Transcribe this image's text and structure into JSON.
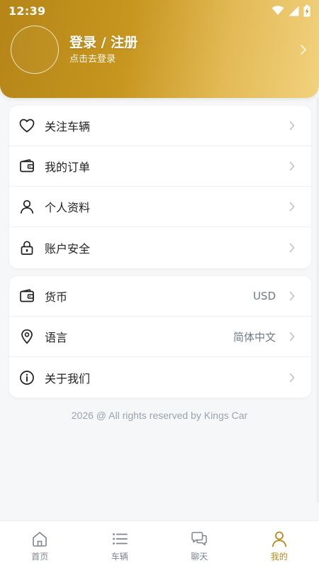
{
  "status_bar": {
    "time": "12:39"
  },
  "header": {
    "login_title": "登录 / 注册",
    "login_subtitle": "点击去登录"
  },
  "menu_group_1": [
    {
      "icon": "heart-icon",
      "label": "关注车辆"
    },
    {
      "icon": "wallet-icon",
      "label": "我的订单"
    },
    {
      "icon": "user-icon",
      "label": "个人资料"
    },
    {
      "icon": "lock-icon",
      "label": "账户安全"
    }
  ],
  "menu_group_2": [
    {
      "icon": "wallet-icon",
      "label": "货币",
      "value": "USD"
    },
    {
      "icon": "location-pin-icon",
      "label": "语言",
      "value": "简体中文"
    },
    {
      "icon": "info-icon",
      "label": "关于我们"
    }
  ],
  "footer": {
    "copyright": "2026 @ All rights reserved by Kings Car"
  },
  "tabbar": [
    {
      "icon": "home-icon",
      "label": "首页",
      "active": false
    },
    {
      "icon": "list-icon",
      "label": "车辆",
      "active": false
    },
    {
      "icon": "chat-icon",
      "label": "聊天",
      "active": false
    },
    {
      "icon": "user-icon",
      "label": "我的",
      "active": true
    }
  ],
  "colors": {
    "accent": "#b8891d",
    "header_start": "#b58618",
    "header_end": "#f2d27e",
    "muted_text": "#6f7a87"
  }
}
